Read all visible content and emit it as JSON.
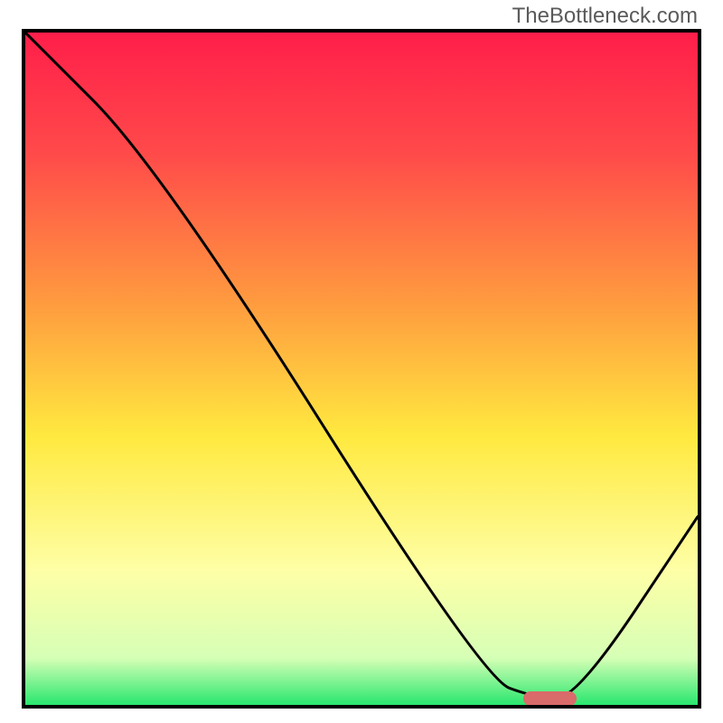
{
  "watermark": "TheBottleneck.com",
  "chart_data": {
    "type": "line",
    "xlabel": "",
    "ylabel": "",
    "xlim": [
      0,
      100
    ],
    "ylim": [
      0,
      100
    ],
    "series": [
      {
        "name": "bottleneck-curve",
        "x": [
          0,
          20,
          68,
          76,
          82,
          100
        ],
        "values": [
          100,
          80,
          4,
          1,
          1,
          28
        ]
      }
    ],
    "marker": {
      "x_start": 74,
      "x_end": 82,
      "y": 1,
      "color": "#d96b6b"
    },
    "gradient_stops": [
      {
        "t": 0.0,
        "color": "#ff1e4a"
      },
      {
        "t": 0.18,
        "color": "#ff4a4a"
      },
      {
        "t": 0.4,
        "color": "#ff9a3f"
      },
      {
        "t": 0.6,
        "color": "#ffe93f"
      },
      {
        "t": 0.8,
        "color": "#feffa6"
      },
      {
        "t": 0.93,
        "color": "#d6ffb6"
      },
      {
        "t": 1.0,
        "color": "#29e76e"
      }
    ],
    "title": ""
  }
}
